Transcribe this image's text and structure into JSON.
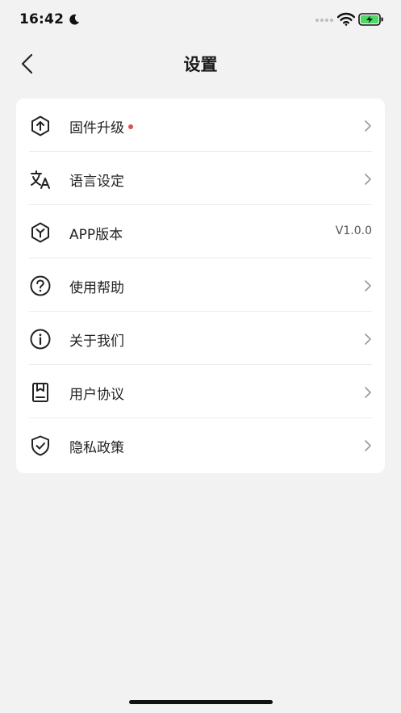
{
  "status_bar": {
    "time": "16:42",
    "icons": [
      "moon-icon",
      "cellular-signal-icon",
      "wifi-icon",
      "battery-charging-icon"
    ],
    "battery_color": "#4cd964"
  },
  "header": {
    "title": "设置",
    "back_icon": "chevron-left-icon"
  },
  "settings": {
    "items": [
      {
        "label": "固件升级",
        "icon": "upload-circle-icon",
        "has_badge": true,
        "trailing": "chevron-right-icon"
      },
      {
        "label": "语言设定",
        "icon": "translate-icon",
        "trailing": "chevron-right-icon"
      },
      {
        "label": "APP版本",
        "icon": "cube-icon",
        "value": "V1.0.0"
      },
      {
        "label": "使用帮助",
        "icon": "help-circle-icon",
        "trailing": "chevron-right-icon"
      },
      {
        "label": "关于我们",
        "icon": "info-circle-icon",
        "trailing": "chevron-right-icon"
      },
      {
        "label": "用户协议",
        "icon": "document-icon",
        "trailing": "chevron-right-icon"
      },
      {
        "label": "隐私政策",
        "icon": "shield-check-icon",
        "trailing": "chevron-right-icon"
      }
    ]
  },
  "colors": {
    "background": "#f2f2f2",
    "card": "#ffffff",
    "badge": "#e05050",
    "chevron": "#9a9a9a"
  }
}
